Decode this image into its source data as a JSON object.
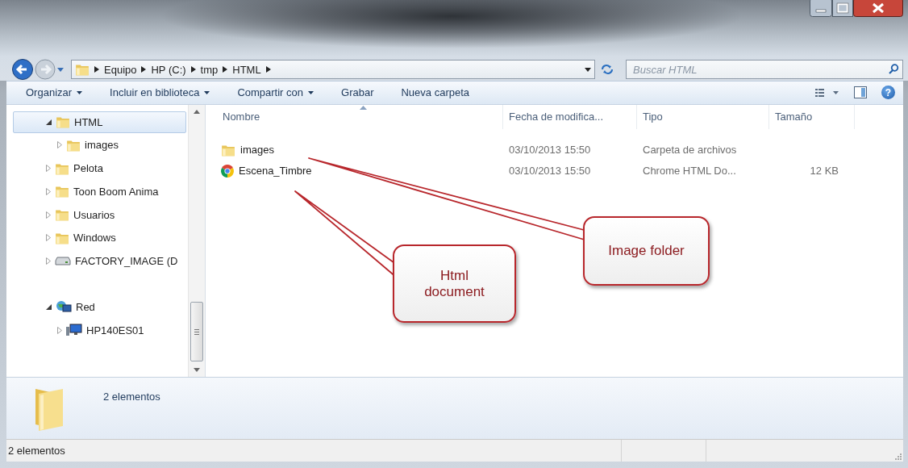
{
  "address_bar": {
    "path": [
      "Equipo",
      "HP (C:)",
      "tmp",
      "HTML"
    ]
  },
  "search": {
    "placeholder": "Buscar HTML"
  },
  "toolbar": {
    "items": [
      {
        "label": "Organizar",
        "has_menu": true
      },
      {
        "label": "Incluir en biblioteca",
        "has_menu": true
      },
      {
        "label": "Compartir con",
        "has_menu": true
      },
      {
        "label": "Grabar",
        "has_menu": false
      },
      {
        "label": "Nueva carpeta",
        "has_menu": false
      }
    ],
    "help": "?"
  },
  "nav_tree": [
    {
      "label": "HTML",
      "kind": "folder",
      "selected": true,
      "expanded": true,
      "children": [
        {
          "label": "images",
          "kind": "folder",
          "selected": false,
          "expanded": false
        }
      ]
    },
    {
      "label": "Pelota",
      "kind": "folder",
      "selected": false,
      "expanded": false
    },
    {
      "label": "Toon Boom Anima",
      "kind": "folder",
      "selected": false,
      "expanded": false
    },
    {
      "label": "Usuarios",
      "kind": "folder",
      "selected": false,
      "expanded": false
    },
    {
      "label": "Windows",
      "kind": "folder",
      "selected": false,
      "expanded": false
    },
    {
      "label": "FACTORY_IMAGE (D",
      "kind": "drive",
      "selected": false,
      "expanded": false
    },
    {
      "label": "Red",
      "kind": "network",
      "selected": false,
      "expanded": true,
      "children": [
        {
          "label": "HP140ES01",
          "kind": "computer",
          "selected": false,
          "expanded": false
        }
      ]
    }
  ],
  "file_list": {
    "columns": [
      {
        "label": "Nombre",
        "sorted": true
      },
      {
        "label": "Fecha de modifica...",
        "sorted": false
      },
      {
        "label": "Tipo",
        "sorted": false
      },
      {
        "label": "Tamaño",
        "sorted": false
      }
    ],
    "rows": [
      {
        "kind": "folder",
        "name": "images",
        "date": "03/10/2013 15:50",
        "type": "Carpeta de archivos"
      },
      {
        "kind": "web",
        "name": "Escena_Timbre",
        "date": "03/10/2013 15:50",
        "type": "Chrome HTML Do...",
        "size": "12 KB"
      }
    ]
  },
  "details_pane": {
    "summary": "2 elementos"
  },
  "status_bar": {
    "text": "2 elementos"
  },
  "callouts": [
    {
      "text": "Image folder"
    },
    {
      "text": "Html document"
    }
  ]
}
